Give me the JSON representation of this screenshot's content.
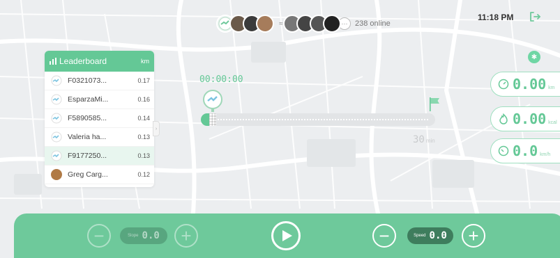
{
  "topbar": {
    "online_count_text": "238 online",
    "time": "11:18 PM",
    "more_label": "···",
    "vs_label": "≈"
  },
  "leaderboard": {
    "title": "Leaderboard",
    "unit": "km",
    "rows": [
      {
        "name": "F0321073...",
        "value": "0.17"
      },
      {
        "name": "EsparzaMi...",
        "value": "0.16"
      },
      {
        "name": "F5890585...",
        "value": "0.14"
      },
      {
        "name": "Valeria ha...",
        "value": "0.13"
      },
      {
        "name": "F9177250...",
        "value": "0.13"
      },
      {
        "name": "Greg Carg...",
        "value": "0.12"
      }
    ],
    "collapse_glyph": "›"
  },
  "track": {
    "elapsed": "00:00:00",
    "target_value": "30",
    "target_unit": "min"
  },
  "stats": {
    "distance": {
      "value": "0.00",
      "unit": "km"
    },
    "calories": {
      "value": "0.00",
      "unit": "kcal"
    },
    "speed": {
      "value": "0.0",
      "unit": "km/h"
    }
  },
  "controls": {
    "slope_label": "Slope",
    "slope_value": "0.0",
    "speed_label": "Speed",
    "speed_value": "0.0",
    "minus_glyph": "−",
    "plus_glyph": "+"
  },
  "colors": {
    "accent": "#64c896",
    "bar": "#6ec99b",
    "pill": "#3e7d5d"
  }
}
